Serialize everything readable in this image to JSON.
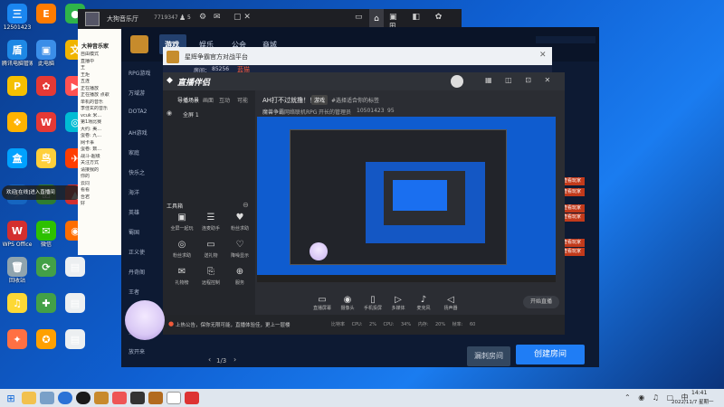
{
  "desktop": {
    "icons": [
      {
        "label": "12501423",
        "color": "#1a86f0",
        "glyph": "三"
      },
      {
        "label": "",
        "color": "#ff7b00",
        "glyph": "E"
      },
      {
        "label": "",
        "color": "#2fb44a",
        "glyph": "●"
      },
      {
        "label": "腾讯电脑管家",
        "color": "#1e88e5",
        "glyph": "盾"
      },
      {
        "label": "此电脑",
        "color": "#3b8ee8",
        "glyph": "▣"
      },
      {
        "label": "",
        "color": "#f0b400",
        "glyph": "文"
      },
      {
        "label": "",
        "color": "#f5c000",
        "glyph": "P"
      },
      {
        "label": "",
        "color": "#e53935",
        "glyph": "✿"
      },
      {
        "label": "",
        "color": "#ff5252",
        "glyph": "▶"
      },
      {
        "label": "",
        "color": "#ffb300",
        "glyph": "❖"
      },
      {
        "label": "",
        "color": "#e53935",
        "glyph": "W"
      },
      {
        "label": "",
        "color": "#00bcd4",
        "glyph": "◎"
      },
      {
        "label": "",
        "color": "#00a1ff",
        "glyph": "盒"
      },
      {
        "label": "",
        "color": "#ffcf3a",
        "glyph": "鸟"
      },
      {
        "label": "",
        "color": "#ff3d00",
        "glyph": "✈"
      },
      {
        "label": "",
        "color": "#1565c0",
        "glyph": "⚡"
      },
      {
        "label": "",
        "color": "#2e7d32",
        "glyph": "☑"
      },
      {
        "label": "",
        "color": "#d32f2f",
        "glyph": "▲"
      },
      {
        "label": "WPS Office",
        "color": "#d32f2f",
        "glyph": "W"
      },
      {
        "label": "微信",
        "color": "#2dc100",
        "glyph": "✉"
      },
      {
        "label": "",
        "color": "#ff6d00",
        "glyph": "◉"
      },
      {
        "label": "回收站",
        "color": "#90a4ae",
        "glyph": "🗑"
      },
      {
        "label": "",
        "color": "#43a047",
        "glyph": "⟳"
      },
      {
        "label": "",
        "color": "#eceff1",
        "glyph": "▤"
      },
      {
        "label": "",
        "color": "#fdd835",
        "glyph": "♫"
      },
      {
        "label": "",
        "color": "#43a047",
        "glyph": "✚"
      },
      {
        "label": "",
        "color": "#eceff1",
        "glyph": "▤"
      },
      {
        "label": "",
        "color": "#ff7043",
        "glyph": "✦"
      },
      {
        "label": "",
        "color": "#ffa000",
        "glyph": "✪"
      },
      {
        "label": "",
        "color": "#eceff1",
        "glyph": "▤"
      }
    ],
    "notification": "欢迎[在线]进入直播间"
  },
  "music": {
    "title": "大狗音乐厅",
    "id": "7719347",
    "likes": "5",
    "sidebar_title": "大神音乐家",
    "sidebar_rows": [
      "自由模式",
      "直播中",
      "王",
      "王炬",
      "五连",
      "正在播放",
      "正在播放 点歌",
      "单机的音乐",
      "李佳玄的音乐",
      "vcuk 米...",
      "第1场比赛",
      "大约: 美...",
      "蛋卷: 九...",
      "网卡事",
      "蛋卷: 数...",
      "战斗-超级",
      "关注方式",
      "请接我的",
      "你的",
      "云同",
      "看看",
      "吾君",
      "好"
    ]
  },
  "launcher": {
    "tabs": [
      "游戏",
      "娱乐",
      "公会",
      "商城"
    ],
    "sidebar": [
      "RPG游戏",
      "万域游",
      "DOTA2",
      "AH游戏",
      "家庭",
      "快乐之",
      "海洋",
      "英雄",
      "蜀国",
      "正义使",
      "丹奇阁",
      "王者",
      "主题曲",
      "全民",
      "放开来"
    ],
    "page": "1/3",
    "bottom_buttons": {
      "history": "漏刺房间",
      "create": "创建房间"
    },
    "orange_tags": [
      "查看玩家",
      "查看玩家",
      "查看玩家",
      "查看玩家",
      "查看玩家",
      "查看玩家"
    ]
  },
  "modal": {
    "title": "星辉争霸官方对战平台",
    "room_prefix": "房间：",
    "room_id": "85256",
    "room_name": "蓝猫"
  },
  "assist": {
    "logo": "直播伴侣",
    "tabs": [
      "导播场景",
      "画面",
      "互动",
      "可能"
    ],
    "scene_label": "全屏 1",
    "stream_title": "AH打不过就撸！！",
    "game_tag": "游戏",
    "category": "#选择适合你的标签",
    "room_info": "魔兽争霸",
    "room_extra": "网络联机RPG",
    "anchor_label": "开长的管理员",
    "stream_id": "10501423",
    "viewers": "95",
    "tool_header": "工具箱",
    "tools": [
      "全屏一起玩",
      "连麦助手",
      "粉丝求助",
      "粉丝求助",
      "送礼物",
      "降噪显示",
      "礼物榜",
      "远程控制",
      "服务"
    ],
    "footer_tip": "上热公告，保你无限可能，直播体验佳，更上一层楼",
    "stats": [
      "比特率",
      "CPU: 2%",
      "CPU: 34%",
      "内存: 20%",
      "帧率: 60"
    ],
    "controls": [
      "直播屏幕",
      "摄像头",
      "手机投屏",
      "多媒体",
      "麦克风",
      "扬声器"
    ],
    "start_button": "开始直播"
  },
  "taskbar": {
    "time": "14:41",
    "date": "2022/11/7 星期一"
  }
}
